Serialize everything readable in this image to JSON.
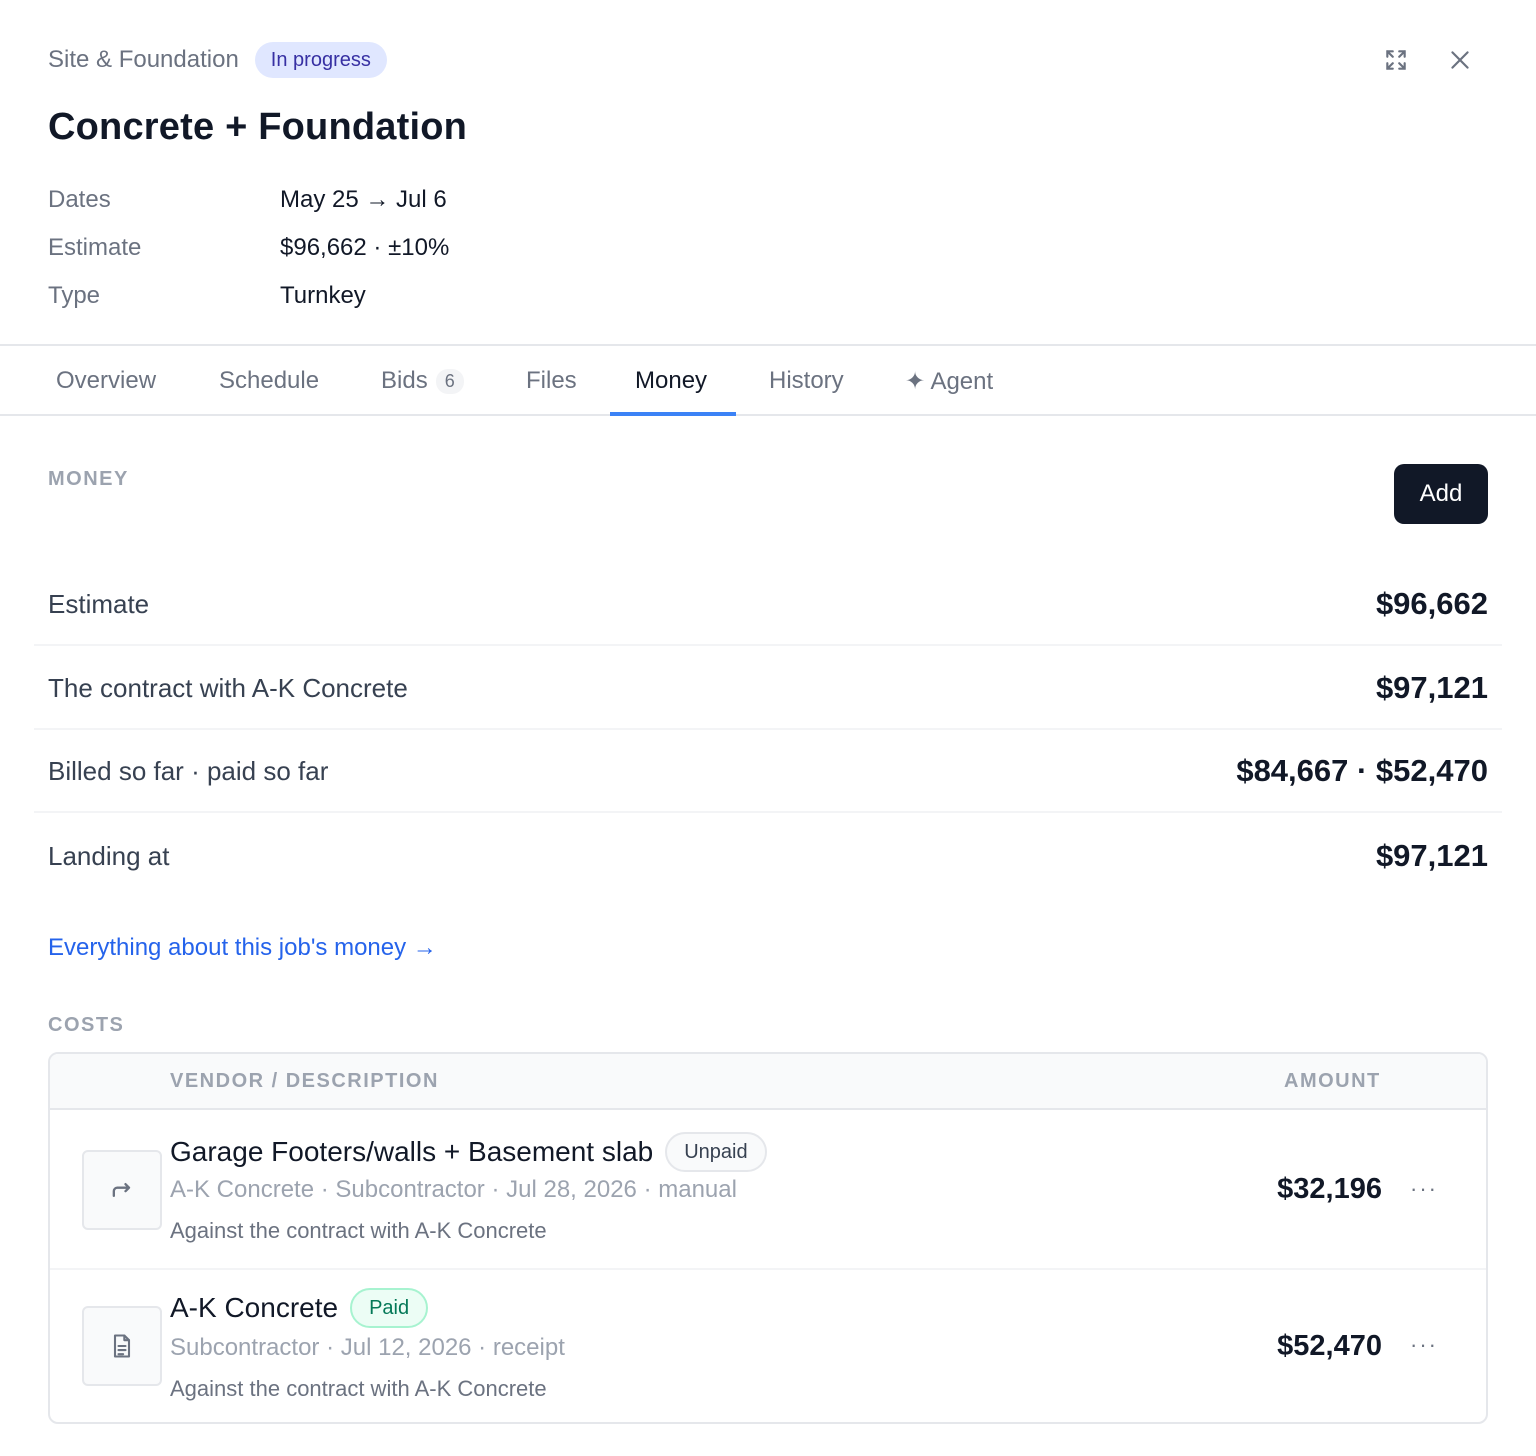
{
  "header": {
    "breadcrumb": "Site & Foundation",
    "status": "In progress",
    "title": "Concrete + Foundation",
    "icons": {
      "expand": "expand-icon",
      "close": "close-icon"
    }
  },
  "meta": [
    {
      "label": "Dates",
      "value": "May 25 → Jul 6"
    },
    {
      "label": "Estimate",
      "value": "$96,662 · ±10%"
    },
    {
      "label": "Type",
      "value": "Turnkey"
    }
  ],
  "tabs": [
    {
      "label": "Overview"
    },
    {
      "label": "Schedule"
    },
    {
      "label": "Bids",
      "count": "6"
    },
    {
      "label": "Files"
    },
    {
      "label": "Money",
      "active": true
    },
    {
      "label": "History"
    },
    {
      "label": "✦ Agent"
    }
  ],
  "money": {
    "section_label": "MONEY",
    "add_label": "Add",
    "rows": [
      {
        "label": "Estimate",
        "value": "$96,662"
      },
      {
        "label": "The contract with A-K Concrete",
        "value": "$97,121"
      },
      {
        "label": "Billed so far · paid so far",
        "value": "$84,667 · $52,470"
      },
      {
        "label": "Landing at",
        "value": "$97,121"
      }
    ],
    "link": "Everything about this job's money →"
  },
  "costs": {
    "section_label": "COSTS",
    "columns": {
      "vendor": "VENDOR / DESCRIPTION",
      "amount": "AMOUNT"
    },
    "rows": [
      {
        "title": "Garage Footers/walls + Basement slab",
        "badge": "Unpaid",
        "sub": "A-K Concrete · Subcontractor · Jul 28, 2026 · manual",
        "note": "Against the contract with A-K Concrete",
        "amount": "$32,196",
        "menu": "···",
        "icon": "forward-arrow-icon"
      },
      {
        "title": "A-K Concrete",
        "badge": "Paid",
        "sub": "Subcontractor · Jul 12, 2026 · receipt",
        "note": "Against the contract with A-K Concrete",
        "amount": "$52,470",
        "menu": "···",
        "icon": "document-icon"
      }
    ]
  },
  "colors": {
    "accent": "#3b82f6",
    "link": "#2563eb",
    "status_bg": "#e0e7ff",
    "status_text": "#3730a3",
    "paid_bg": "#ecfdf5",
    "paid_text": "#047857",
    "primary_button": "#111827"
  }
}
